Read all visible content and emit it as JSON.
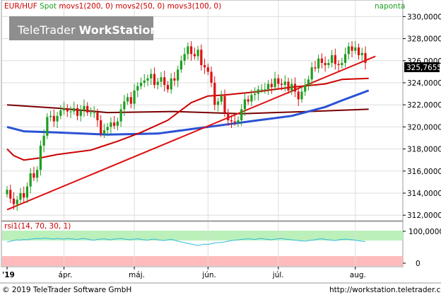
{
  "header": {
    "instrument": "EUR/HUF",
    "spot": "Spot",
    "ma1": "movs1(200, 0)",
    "ma2": "movs2(50, 0)",
    "ma3": "movs3(100, 0)",
    "period": "naponta"
  },
  "watermark": {
    "brand": "TeleTrader",
    "product": "WorkStation"
  },
  "price_label": "325,7655",
  "rsi_panel": {
    "label": "rsi1(14, 70, 30, 1)",
    "ticks": [
      "100,0000",
      "0"
    ]
  },
  "footer": {
    "copyright": "© 2019 TeleTrader Software GmbH",
    "url": "http://workstation.teletrader.com"
  },
  "colors": {
    "candle_up": "#1e9e1e",
    "candle_down": "#dd1111",
    "ma1": "#7a0000",
    "ma2": "#2a52d4",
    "ma3": "#cc0000",
    "trendline": "#dd1111",
    "rsi_line": "#33bbdd",
    "overbought_band": "#bbf0bb",
    "oversold_band": "#ffbbbb"
  },
  "chart_data": {
    "type": "candlestick",
    "title": "EUR/HUF Spot",
    "ylim": [
      311.5,
      331.5
    ],
    "y_ticks": [
      312,
      314,
      316,
      318,
      320,
      322,
      324,
      326,
      328,
      330
    ],
    "y_tick_labels": [
      "312,0000",
      "314,0000",
      "316,0000",
      "318,0000",
      "320,0000",
      "322,0000",
      "324,0000",
      "326,0000",
      "328,0000",
      "330,0000"
    ],
    "x_labels": [
      "'19",
      "ápr.",
      "máj.",
      "jún.",
      "júl.",
      "aug."
    ],
    "x_label_positions": [
      0,
      17,
      38,
      60,
      81,
      104
    ],
    "n_days": 108,
    "close": [
      314.3,
      313.5,
      313.0,
      313.4,
      314.0,
      313.6,
      314.6,
      315.8,
      315.4,
      316.1,
      318.3,
      319.2,
      320.9,
      321.0,
      320.5,
      321.0,
      321.5,
      321.7,
      321.4,
      321.4,
      321.7,
      321.0,
      321.5,
      321.9,
      321.3,
      321.3,
      321.3,
      320.6,
      319.4,
      319.7,
      320.0,
      320.4,
      320.1,
      320.5,
      321.6,
      322.3,
      322.7,
      322.1,
      323.3,
      323.7,
      324.0,
      324.2,
      324.4,
      324.8,
      323.8,
      324.1,
      324.5,
      323.8,
      323.4,
      324.4,
      324.2,
      325.2,
      326.0,
      326.6,
      327.3,
      326.6,
      326.4,
      327.0,
      325.6,
      325.4,
      325.0,
      324.0,
      322.0,
      322.3,
      322.8,
      321.3,
      320.6,
      320.5,
      320.4,
      320.6,
      321.6,
      322.5,
      322.3,
      322.9,
      323.0,
      323.4,
      323.4,
      323.4,
      323.9,
      323.6,
      324.4,
      323.9,
      323.8,
      324.1,
      323.3,
      323.9,
      323.2,
      322.5,
      323.2,
      323.8,
      324.3,
      325.4,
      325.3,
      326.2,
      325.8,
      325.6,
      325.8,
      326.5,
      325.7,
      325.6,
      325.8,
      326.6,
      327.3,
      326.9,
      327.2,
      326.5,
      326.7,
      325.8
    ],
    "ma1_200": [
      [
        0,
        322.0
      ],
      [
        15,
        321.7
      ],
      [
        30,
        321.3
      ],
      [
        50,
        321.4
      ],
      [
        70,
        321.2
      ],
      [
        90,
        321.4
      ],
      [
        108,
        321.6
      ]
    ],
    "ma2_50": [
      [
        0,
        320.0
      ],
      [
        5,
        319.6
      ],
      [
        15,
        319.5
      ],
      [
        30,
        319.3
      ],
      [
        45,
        319.4
      ],
      [
        55,
        319.8
      ],
      [
        65,
        320.2
      ],
      [
        75,
        320.6
      ],
      [
        85,
        321.0
      ],
      [
        95,
        321.8
      ],
      [
        100,
        322.4
      ],
      [
        108,
        323.3
      ]
    ],
    "ma3_100": [
      [
        0,
        318.0
      ],
      [
        2,
        317.4
      ],
      [
        5,
        317.0
      ],
      [
        10,
        317.2
      ],
      [
        15,
        317.5
      ],
      [
        25,
        317.9
      ],
      [
        28,
        318.2
      ],
      [
        33,
        318.7
      ],
      [
        40,
        319.5
      ],
      [
        48,
        320.6
      ],
      [
        55,
        322.2
      ],
      [
        60,
        322.8
      ],
      [
        65,
        322.9
      ],
      [
        75,
        323.2
      ],
      [
        85,
        323.6
      ],
      [
        95,
        323.9
      ],
      [
        100,
        324.3
      ],
      [
        108,
        324.4
      ]
    ],
    "trendline": [
      [
        0,
        312.5
      ],
      [
        110,
        326.4
      ]
    ],
    "rsi": [
      68,
      70,
      72,
      74,
      73,
      75,
      74,
      76,
      77,
      78,
      77,
      79,
      78,
      77,
      76,
      78,
      77,
      76,
      78,
      77,
      76,
      75,
      77,
      78,
      76,
      74,
      73,
      75,
      76,
      77,
      75,
      74,
      76,
      77,
      78,
      76,
      75,
      74,
      76,
      77,
      75,
      74,
      73,
      75,
      76,
      74,
      73,
      72,
      74,
      75,
      73,
      70,
      68,
      66,
      64,
      62,
      60,
      58,
      60,
      62,
      61,
      63,
      65,
      66,
      67,
      68,
      70,
      72,
      73,
      74,
      75,
      76,
      77,
      76,
      75,
      77,
      78,
      76,
      75,
      74,
      76,
      77,
      78,
      76,
      75,
      74,
      73,
      72,
      71,
      70,
      72,
      73,
      74,
      76,
      77,
      75,
      74,
      73,
      72,
      74,
      75,
      76,
      75,
      74,
      73,
      71,
      70,
      69
    ]
  }
}
